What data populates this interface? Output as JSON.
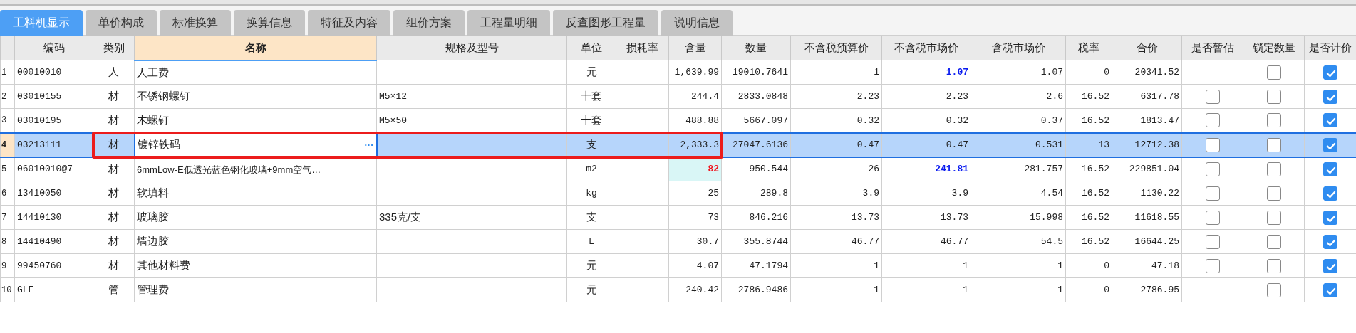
{
  "tabs": [
    {
      "label": "工料机显示",
      "selected": true
    },
    {
      "label": "单价构成",
      "selected": false
    },
    {
      "label": "标准换算",
      "selected": false
    },
    {
      "label": "换算信息",
      "selected": false
    },
    {
      "label": "特征及内容",
      "selected": false
    },
    {
      "label": "组价方案",
      "selected": false
    },
    {
      "label": "工程量明细",
      "selected": false
    },
    {
      "label": "反查图形工程量",
      "selected": false
    },
    {
      "label": "说明信息",
      "selected": false
    }
  ],
  "table": {
    "columns": [
      {
        "label": "编码",
        "kind": "left",
        "active": false,
        "framed": false
      },
      {
        "label": "类别",
        "kind": "center",
        "active": false,
        "framed": true
      },
      {
        "label": "名称",
        "kind": "left",
        "active": true,
        "framed": true
      },
      {
        "label": "规格及型号",
        "kind": "left",
        "active": false,
        "framed": true
      },
      {
        "label": "单位",
        "kind": "center",
        "active": false,
        "framed": true
      },
      {
        "label": "损耗率",
        "kind": "right",
        "active": false,
        "framed": true
      },
      {
        "label": "含量",
        "kind": "right",
        "active": false,
        "framed": true
      },
      {
        "label": "数量",
        "kind": "right",
        "active": false,
        "framed": false
      },
      {
        "label": "不含税预算价",
        "kind": "right",
        "active": false,
        "framed": false
      },
      {
        "label": "不含税市场价",
        "kind": "right",
        "active": false,
        "framed": false
      },
      {
        "label": "含税市场价",
        "kind": "right",
        "active": false,
        "framed": false
      },
      {
        "label": "税率",
        "kind": "right",
        "active": false,
        "framed": false
      },
      {
        "label": "合价",
        "kind": "right",
        "active": false,
        "framed": false
      },
      {
        "label": "是否暂估",
        "kind": "check",
        "active": false,
        "framed": false
      },
      {
        "label": "锁定数量",
        "kind": "check",
        "active": false,
        "framed": false
      },
      {
        "label": "是否计价",
        "kind": "check",
        "active": false,
        "framed": false
      }
    ],
    "rows": [
      {
        "no": "1",
        "selected": false,
        "framed": false,
        "editing": false,
        "market_adjusted": true,
        "content_edited": false,
        "cells": [
          "00010010",
          "人",
          "人工费",
          null,
          "元",
          null,
          "1,639.99",
          "19010.7641",
          "1",
          "1.07",
          "1.07",
          "0",
          "20341.52"
        ],
        "locked": false,
        "priced": true
      },
      {
        "no": "2",
        "selected": false,
        "framed": false,
        "editing": false,
        "market_adjusted": false,
        "content_edited": false,
        "cells": [
          "03010155",
          "材",
          "不锈钢螺钉",
          "M5×12",
          "十套",
          null,
          "244.4",
          "2833.0848",
          "2.23",
          "2.23",
          "2.6",
          "16.52",
          "6317.78"
        ],
        "provisional": false,
        "locked": false,
        "priced": true
      },
      {
        "no": "3",
        "selected": false,
        "framed": false,
        "editing": false,
        "market_adjusted": false,
        "content_edited": false,
        "cells": [
          "03010195",
          "材",
          "木螺钉",
          "M5×50",
          "十套",
          null,
          "488.88",
          "5667.097",
          "0.32",
          "0.32",
          "0.37",
          "16.52",
          "1813.47"
        ],
        "provisional": false,
        "locked": false,
        "priced": true
      },
      {
        "no": "4",
        "selected": true,
        "framed": true,
        "editing": true,
        "edit_button": "···",
        "market_adjusted": false,
        "content_edited": false,
        "cells": [
          "03213111",
          "材",
          "镀锌铁码",
          null,
          "支",
          null,
          "2,333.3",
          "27047.6136",
          "0.47",
          "0.47",
          "0.531",
          "13",
          "12712.38"
        ],
        "provisional": false,
        "locked": false,
        "priced": true
      },
      {
        "no": "5",
        "selected": false,
        "framed": false,
        "editing": false,
        "market_adjusted": true,
        "content_edited": true,
        "cells": [
          "06010010@7",
          "材",
          "6mmLow-E低透光蓝色钢化玻璃+9mm空气…",
          null,
          "m2",
          null,
          "82",
          "950.544",
          "26",
          "241.81",
          "281.757",
          "16.52",
          "229851.04"
        ],
        "provisional": false,
        "locked": false,
        "priced": true
      },
      {
        "no": "6",
        "selected": false,
        "framed": false,
        "editing": false,
        "market_adjusted": false,
        "content_edited": false,
        "cells": [
          "13410050",
          "材",
          "软填料",
          null,
          "kg",
          null,
          "25",
          "289.8",
          "3.9",
          "3.9",
          "4.54",
          "16.52",
          "1130.22"
        ],
        "provisional": false,
        "locked": false,
        "priced": true
      },
      {
        "no": "7",
        "selected": false,
        "framed": false,
        "editing": false,
        "market_adjusted": false,
        "content_edited": false,
        "cells": [
          "14410130",
          "材",
          "玻璃胶",
          "335克/支",
          "支",
          null,
          "73",
          "846.216",
          "13.73",
          "13.73",
          "15.998",
          "16.52",
          "11618.55"
        ],
        "provisional": false,
        "locked": false,
        "priced": true
      },
      {
        "no": "8",
        "selected": false,
        "framed": false,
        "editing": false,
        "market_adjusted": false,
        "content_edited": false,
        "cells": [
          "14410490",
          "材",
          "墙边胶",
          null,
          "L",
          null,
          "30.7",
          "355.8744",
          "46.77",
          "46.77",
          "54.5",
          "16.52",
          "16644.25"
        ],
        "provisional": false,
        "locked": false,
        "priced": true
      },
      {
        "no": "9",
        "selected": false,
        "framed": false,
        "editing": false,
        "market_adjusted": false,
        "content_edited": false,
        "cells": [
          "99450760",
          "材",
          "其他材料费",
          null,
          "元",
          null,
          "4.07",
          "47.1794",
          "1",
          "1",
          "1",
          "0",
          "47.18"
        ],
        "provisional": false,
        "locked": false,
        "priced": true
      },
      {
        "no": "10",
        "selected": false,
        "framed": false,
        "editing": false,
        "market_adjusted": false,
        "content_edited": false,
        "cells": [
          "GLF",
          "管",
          "管理费",
          null,
          "元",
          null,
          "240.42",
          "2786.9486",
          "1",
          "1",
          "1",
          "0",
          "2786.95"
        ],
        "locked": false,
        "priced": true
      }
    ]
  }
}
